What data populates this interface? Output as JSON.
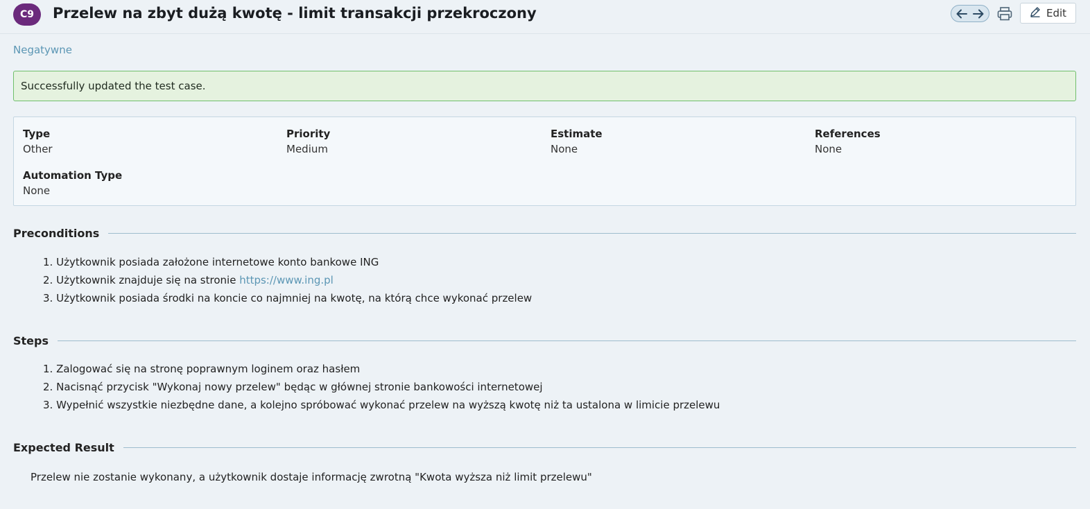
{
  "header": {
    "case_id": "C9",
    "title": "Przelew na zbyt dużą kwotę - limit transakcji przekroczony",
    "edit_label": "Edit",
    "badge_color": "#6b2a7c"
  },
  "section_link": "Negatywne",
  "alert": {
    "message": "Successfully updated the test case."
  },
  "fields": {
    "type": {
      "label": "Type",
      "value": "Other"
    },
    "priority": {
      "label": "Priority",
      "value": "Medium"
    },
    "estimate": {
      "label": "Estimate",
      "value": "None"
    },
    "references": {
      "label": "References",
      "value": "None"
    },
    "automation_type": {
      "label": "Automation Type",
      "value": "None"
    }
  },
  "preconditions": {
    "title": "Preconditions",
    "items": [
      {
        "num": "1.",
        "text": "Użytkownik posiada założone internetowe konto bankowe ING"
      },
      {
        "num": "2.",
        "text": "Użytkownik znajduje się na stronie ",
        "link": "https://www.ing.pl"
      },
      {
        "num": "3.",
        "text": "Użytkownik posiada środki na koncie co najmniej na kwotę, na którą chce wykonać przelew"
      }
    ]
  },
  "steps": {
    "title": "Steps",
    "items": [
      {
        "num": "1.",
        "text": "Zalogować się na stronę poprawnym loginem oraz hasłem"
      },
      {
        "num": "2.",
        "text": "Nacisnąć przycisk \"Wykonaj nowy przelew\" będąc w głównej stronie bankowości internetowej"
      },
      {
        "num": "3.",
        "text": "Wypełnić wszystkie niezbędne dane, a kolejno spróbować wykonać przelew na wyższą kwotę niż ta ustalona w limicie przelewu"
      }
    ]
  },
  "expected_result": {
    "title": "Expected Result",
    "text": "Przelew nie zostanie wykonany, a użytkownik dostaje informację zwrotną \"Kwota wyższa niż limit przelewu\""
  },
  "icons": {
    "prev": "arrow-left-icon",
    "next": "arrow-right-icon",
    "print": "printer-icon",
    "edit": "pencil-icon"
  }
}
